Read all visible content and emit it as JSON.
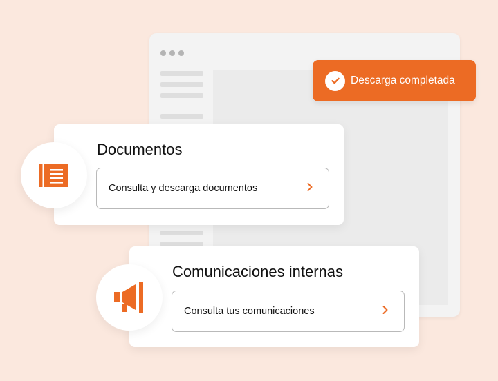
{
  "toast": {
    "text": "Descarga completada",
    "icon": "check-icon"
  },
  "cards": [
    {
      "title": "Documentos",
      "action_label": "Consulta y descarga documentos",
      "icon": "document-icon"
    },
    {
      "title": "Comunicaciones internas",
      "action_label": "Consulta tus comunicaciones",
      "icon": "megaphone-icon"
    }
  ],
  "colors": {
    "accent": "#ec6b24",
    "background": "#fbe8de",
    "border": "#b9b9b9"
  }
}
